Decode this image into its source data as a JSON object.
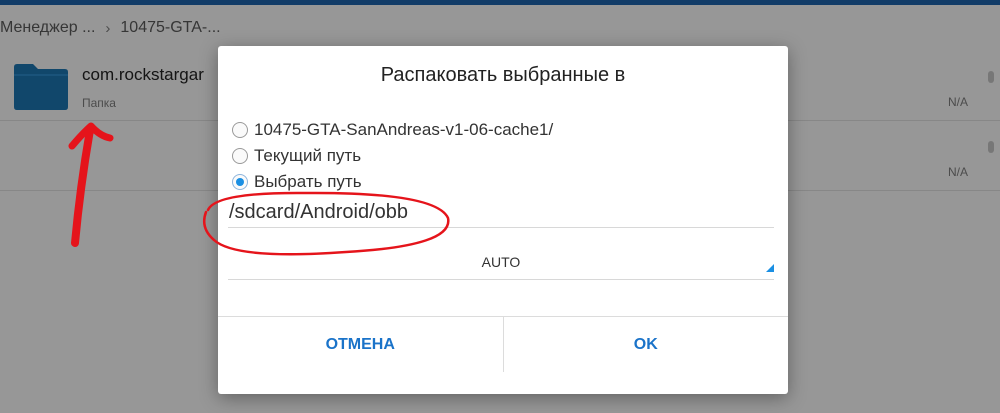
{
  "breadcrumb": {
    "items": [
      "Менеджер ...",
      "10475-GTA-..."
    ],
    "separator": "›"
  },
  "files": [
    {
      "name": "com.rockstargar",
      "type": "Папка",
      "size": "N/A"
    },
    {
      "name": "",
      "type": "",
      "size": "N/A"
    }
  ],
  "dialog": {
    "title": "Распаковать выбранные в",
    "options": [
      {
        "label": "10475-GTA-SanAndreas-v1-06-cache1/",
        "checked": false
      },
      {
        "label": "Текущий путь",
        "checked": false
      },
      {
        "label": "Выбрать путь",
        "checked": true
      }
    ],
    "path_value": "/sdcard/Android/obb",
    "encoding_value": "AUTO",
    "cancel_label": "ОТМЕНА",
    "ok_label": "OK"
  },
  "colors": {
    "accent": "#1a8fe3",
    "button_text": "#1a73c9",
    "folder": "#1c6fa8",
    "annotation": "#e5141b"
  }
}
